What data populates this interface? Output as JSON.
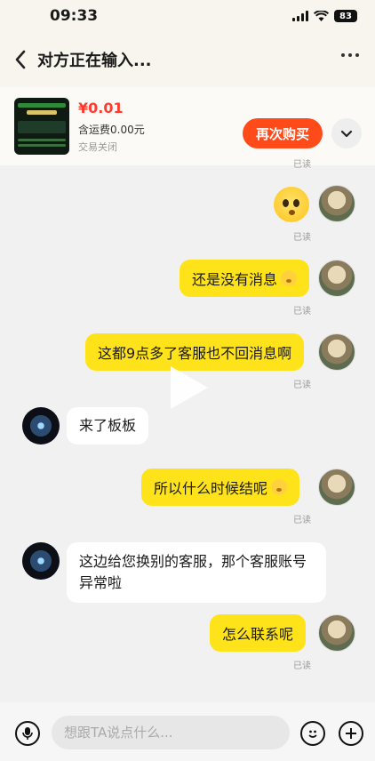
{
  "status_bar": {
    "time": "09:33",
    "battery": "83"
  },
  "header": {
    "title": "对方正在输入..."
  },
  "product": {
    "price": "¥0.01",
    "shipping": "含运费0.00元",
    "status": "交易关闭",
    "rebuy_label": "再次购买"
  },
  "read_label": "已读",
  "messages": [
    {
      "from": "me",
      "type": "sticker",
      "text": ""
    },
    {
      "from": "me",
      "type": "text",
      "text": "还是没有消息"
    },
    {
      "from": "me",
      "type": "text",
      "text": "这都9点多了客服也不回消息啊"
    },
    {
      "from": "other",
      "type": "text",
      "text": "来了板板"
    },
    {
      "from": "me",
      "type": "text",
      "text": "所以什么时候结呢"
    },
    {
      "from": "other",
      "type": "text",
      "text": "这边给您换别的客服，那个客服账号异常啦"
    },
    {
      "from": "me",
      "type": "text",
      "text": "怎么联系呢"
    }
  ],
  "input": {
    "placeholder": "想跟TA说点什么..."
  },
  "colors": {
    "accent": "#ffe31a",
    "price": "#ff3b2f",
    "button": "#ff4a1a"
  }
}
